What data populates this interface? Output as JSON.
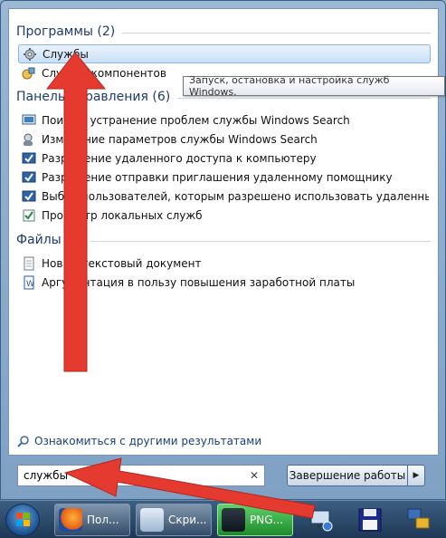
{
  "programs": {
    "header": "Программы (2)",
    "items": [
      {
        "label": "Службы",
        "icon": "services-gear-icon",
        "selected": true
      },
      {
        "label": "Службы компонентов",
        "icon": "component-services-icon"
      }
    ]
  },
  "tooltip": "Запуск, остановка и настройка служб Windows.",
  "control_panel": {
    "header": "Панель управления (6)",
    "items": [
      {
        "label": "Поиск и устранение проблем службы Windows Search",
        "icon": "troubleshoot-icon"
      },
      {
        "label": "Изменение параметров службы Windows Search",
        "icon": "indexing-user-icon"
      },
      {
        "label": "Разрешение удаленного доступа к компьютеру",
        "icon": "system-checkbox-icon"
      },
      {
        "label": "Разрешение отправки приглашения удаленному помощнику",
        "icon": "system-checkbox-icon"
      },
      {
        "label": "Выбор пользователей, которым разрешено использовать удаленный рабоч...",
        "icon": "system-checkbox-icon"
      },
      {
        "label": "Просмотр локальных служб",
        "icon": "local-services-icon"
      }
    ]
  },
  "files": {
    "header": "Файлы (2)",
    "items": [
      {
        "label": "Новый текстовый документ",
        "icon": "text-document-icon"
      },
      {
        "label": "Аргументация в пользу повышения заработной платы",
        "icon": "word-document-icon"
      }
    ]
  },
  "more_results": "Ознакомиться с другими результатами",
  "search": {
    "value": "службы",
    "clear": "✕"
  },
  "shutdown": {
    "label": "Завершение работы",
    "arrow": "▶"
  },
  "taskbar": {
    "buttons": [
      {
        "label": "Пол...",
        "icon": "firefox-icon"
      },
      {
        "label": "Скри...",
        "icon": "scissors-icon"
      },
      {
        "label": "PNG...",
        "icon": "png-tool-icon",
        "active": true
      }
    ]
  },
  "colors": {
    "arrow": "#e53a2f",
    "selection": "#c9e0f7",
    "accent": "#1e3a70"
  }
}
